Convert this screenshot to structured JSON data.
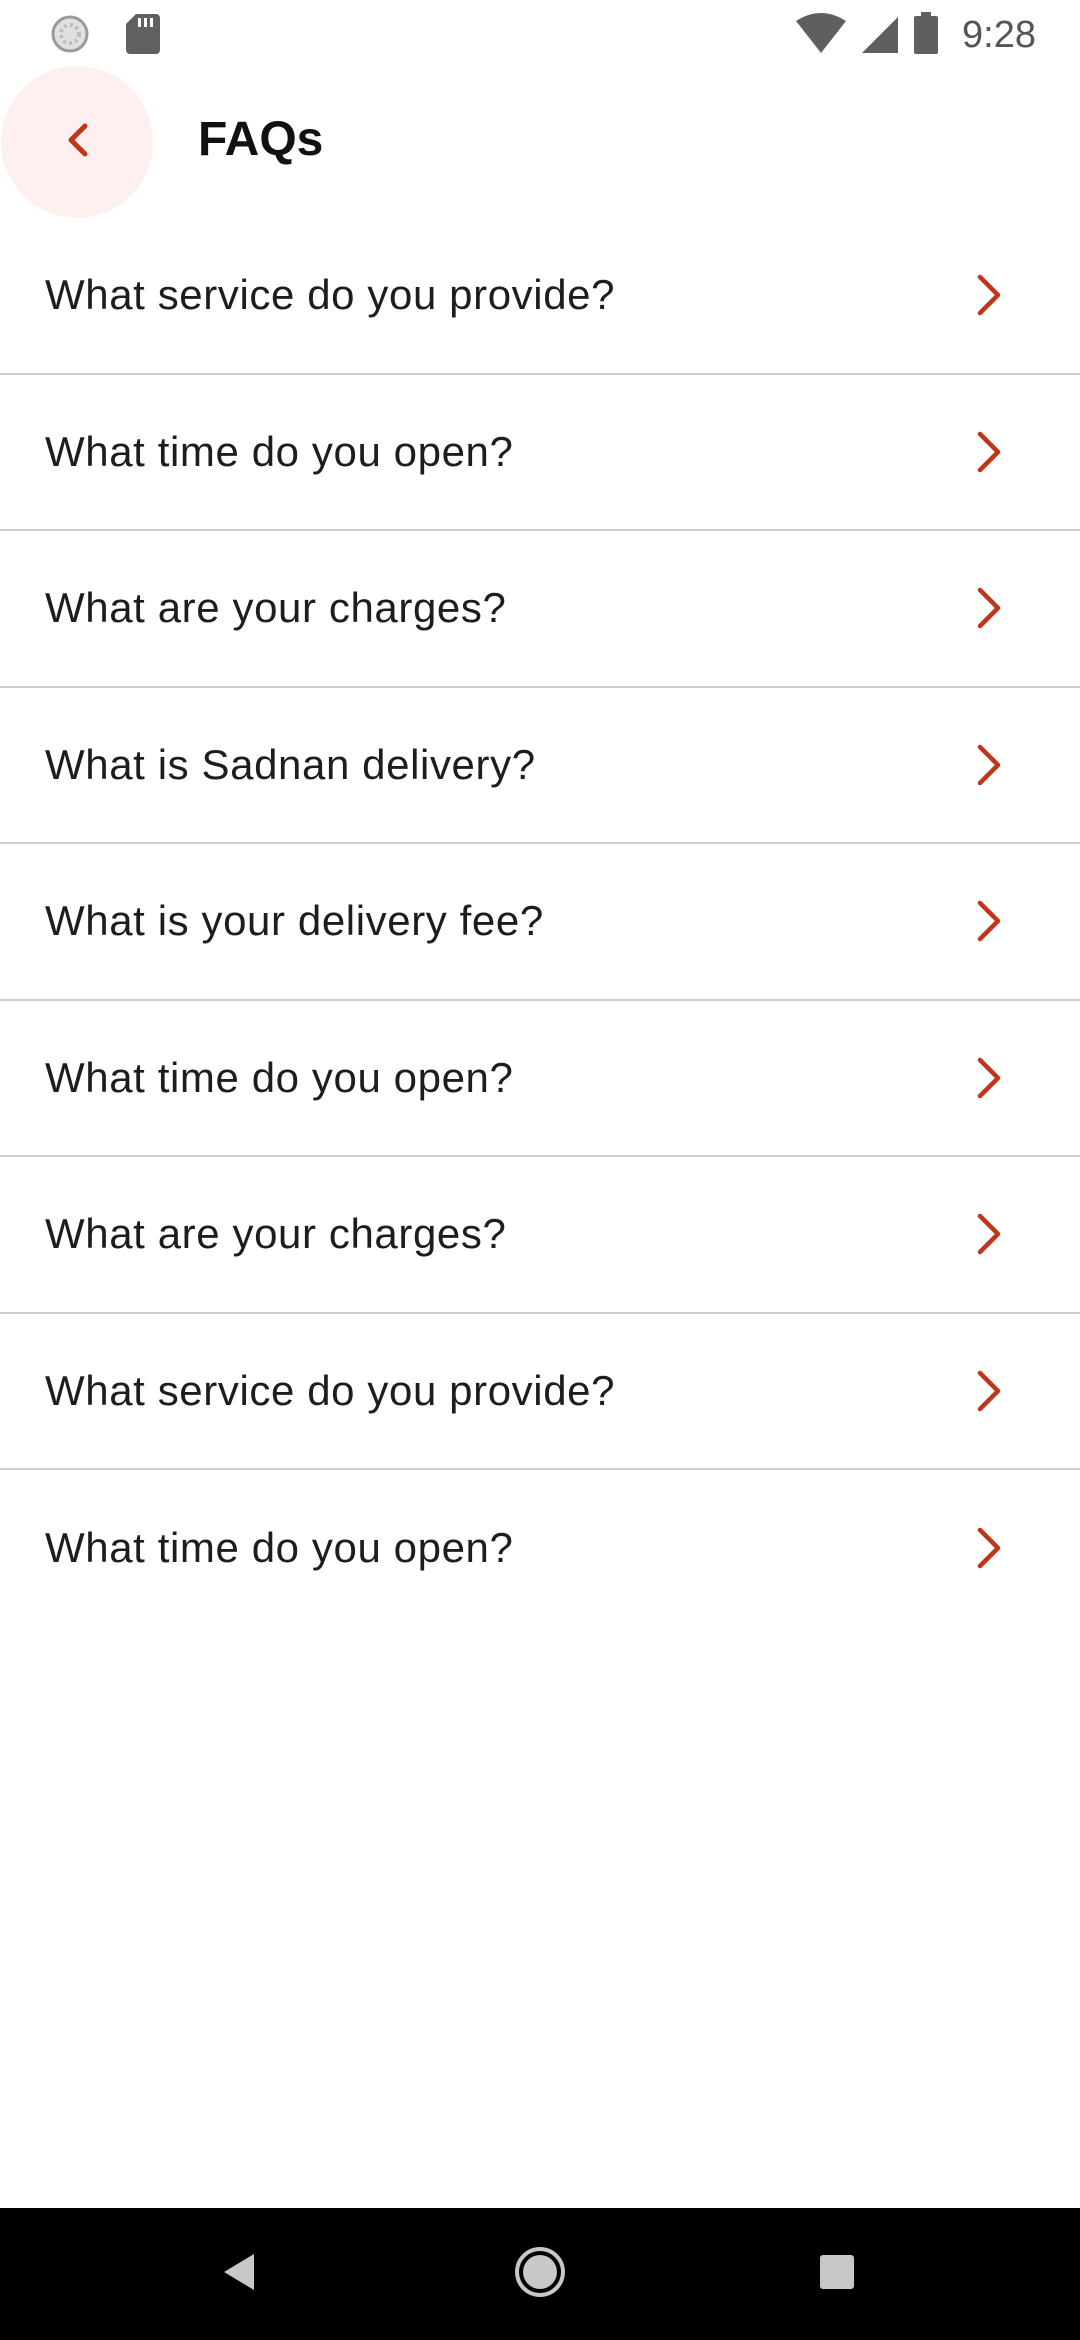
{
  "status_bar": {
    "time": "9:28",
    "icons": [
      "loading-icon",
      "sd-card-icon",
      "wifi-icon",
      "cellular-signal-icon",
      "battery-icon"
    ]
  },
  "app_bar": {
    "title": "FAQs",
    "back_icon": "chevron-left-icon"
  },
  "faq": {
    "items": [
      {
        "question": "What service do you provide?"
      },
      {
        "question": "What time do you open?"
      },
      {
        "question": "What are your charges?"
      },
      {
        "question": "What is Sadnan delivery?"
      },
      {
        "question": "What is your delivery fee?"
      },
      {
        "question": "What time do you open?"
      },
      {
        "question": "What are your charges?"
      },
      {
        "question": "What service do you provide?"
      },
      {
        "question": "What time do you open?"
      }
    ]
  },
  "nav_bar": {
    "buttons": [
      "back-triangle-icon",
      "home-circle-icon",
      "recents-square-icon"
    ]
  },
  "colors": {
    "accent": "#c0361b",
    "divider": "#cfcfcf",
    "text": "#1d1d1d",
    "back_button_bg": "#fdf0ee",
    "nav_bar_bg": "#000000"
  }
}
